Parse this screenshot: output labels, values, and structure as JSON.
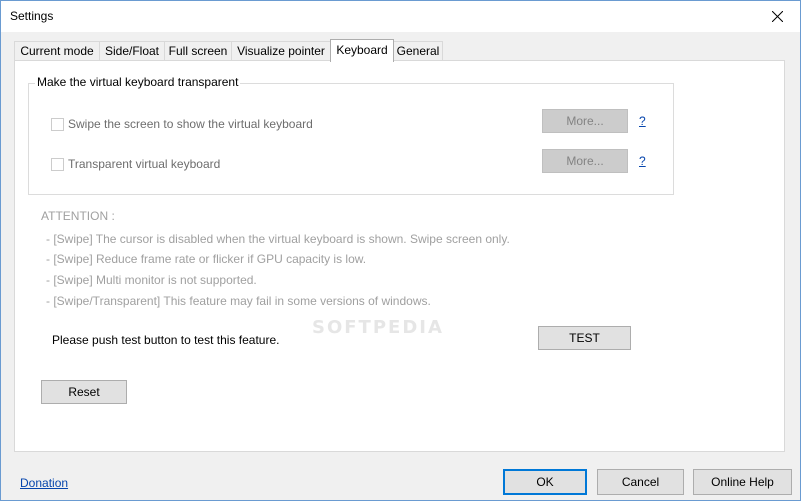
{
  "window": {
    "title": "Settings"
  },
  "tabs": [
    {
      "label": "Current mode",
      "active": false
    },
    {
      "label": "Side/Float",
      "active": false
    },
    {
      "label": "Full screen",
      "active": false
    },
    {
      "label": "Visualize pointer",
      "active": false
    },
    {
      "label": "Keyboard",
      "active": true
    },
    {
      "label": "General",
      "active": false
    }
  ],
  "group": {
    "title": "Make the virtual keyboard transparent",
    "items": [
      {
        "label": "Swipe the screen to show the virtual keyboard",
        "checked": false,
        "enabled": false,
        "more_label": "More...",
        "help_label": "?"
      },
      {
        "label": "Transparent virtual keyboard",
        "checked": false,
        "enabled": false,
        "more_label": "More...",
        "help_label": "?"
      }
    ]
  },
  "attention": {
    "heading": "ATTENTION :",
    "lines": [
      "- [Swipe] The cursor is disabled when the virtual keyboard is shown. Swipe screen only.",
      "- [Swipe] Reduce frame rate or flicker if GPU capacity is low.",
      "- [Swipe] Multi monitor is not supported.",
      "- [Swipe/Transparent] This feature may fail in some versions of windows."
    ]
  },
  "test": {
    "prompt": "Please push test button to test this feature.",
    "button_label": "TEST"
  },
  "reset_label": "Reset",
  "footer": {
    "donation_label": "Donation",
    "ok_label": "OK",
    "cancel_label": "Cancel",
    "help_label": "Online Help"
  },
  "watermark": "SOFTPEDIA",
  "colors": {
    "link": "#0645ad",
    "default_button_border": "#0078d7",
    "disabled_text": "#838383"
  }
}
